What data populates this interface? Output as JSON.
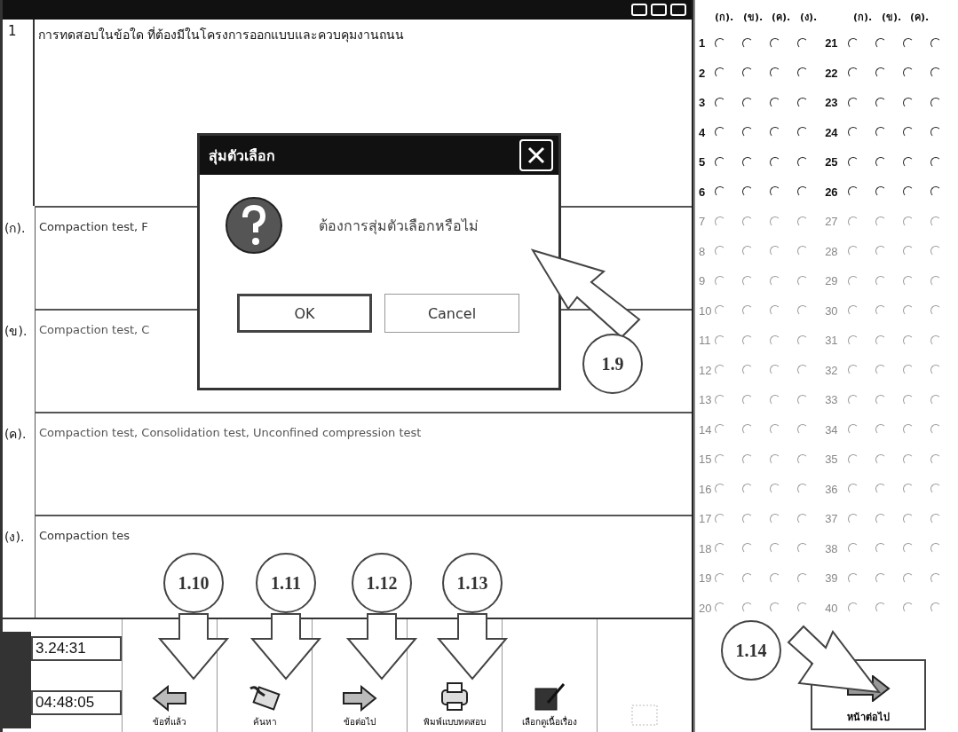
{
  "question": {
    "number": "1",
    "text": "การทดสอบในข้อใด ที่ต้องมีในโครงการออกแบบและควบคุมงานถนน"
  },
  "options": [
    {
      "label": "(ก).",
      "text": "Compaction test, F"
    },
    {
      "label": "(ข).",
      "text": "Compaction test, C"
    },
    {
      "label": "(ค).",
      "text": "Compaction test, Consolidation test, Unconfined compression test"
    },
    {
      "label": "(ง).",
      "text": "Compaction tes"
    }
  ],
  "dialog": {
    "title": "สุ่มตัวเลือก",
    "message": "ต้องการสุ่มตัวเลือกหรือไม่",
    "buttons": [
      "OK",
      "Cancel"
    ]
  },
  "timers": [
    "3.24:31",
    "04:48:05"
  ],
  "toolbar": [
    {
      "kind": "back",
      "label": "ข้อที่แล้ว"
    },
    {
      "kind": "search",
      "label": "ค้นหา"
    },
    {
      "kind": "next",
      "label": "ข้อต่อไป"
    },
    {
      "kind": "print",
      "label": "พิมพ์แบบทดสอบ"
    },
    {
      "kind": "story",
      "label": "เลือกดูเนื้อเรื่อง"
    },
    {
      "kind": "blank"
    }
  ],
  "answer_grid": {
    "headers": [
      "(ก).",
      "(ข).",
      "(ค).",
      "(ง)."
    ],
    "headers_right": [
      "(ก).",
      "(ข).",
      "(ค)."
    ],
    "rows": [
      {
        "left": {
          "number": "1",
          "disabled": false,
          "checked": [
            false,
            false,
            false,
            false
          ]
        },
        "right": {
          "number": "21",
          "disabled": false,
          "checked": [
            false,
            false,
            false,
            false
          ]
        }
      },
      {
        "left": {
          "number": "2",
          "disabled": false,
          "checked": [
            false,
            false,
            false,
            false
          ]
        },
        "right": {
          "number": "22",
          "disabled": false,
          "checked": [
            false,
            false,
            false,
            false
          ]
        }
      },
      {
        "left": {
          "number": "3",
          "disabled": false,
          "checked": [
            false,
            false,
            false,
            false
          ]
        },
        "right": {
          "number": "23",
          "disabled": false,
          "checked": [
            false,
            false,
            false,
            false
          ]
        }
      },
      {
        "left": {
          "number": "4",
          "disabled": false,
          "checked": [
            false,
            false,
            false,
            false
          ]
        },
        "right": {
          "number": "24",
          "disabled": false,
          "checked": [
            false,
            false,
            false,
            false
          ]
        }
      },
      {
        "left": {
          "number": "5",
          "disabled": false,
          "checked": [
            false,
            false,
            false,
            false
          ]
        },
        "right": {
          "number": "25",
          "disabled": false,
          "checked": [
            false,
            false,
            false,
            false
          ]
        }
      },
      {
        "left": {
          "number": "6",
          "disabled": false,
          "checked": [
            false,
            false,
            false,
            false
          ]
        },
        "right": {
          "number": "26",
          "disabled": false,
          "checked": [
            false,
            false,
            false,
            false
          ]
        }
      },
      {
        "left": {
          "number": "7",
          "disabled": true,
          "checked": [
            false,
            false,
            false,
            false
          ]
        },
        "right": {
          "number": "27",
          "disabled": true,
          "checked": [
            false,
            false,
            false,
            false
          ]
        }
      },
      {
        "left": {
          "number": "8",
          "disabled": true,
          "checked": [
            false,
            false,
            false,
            false
          ]
        },
        "right": {
          "number": "28",
          "disabled": true,
          "checked": [
            false,
            false,
            false,
            false
          ]
        }
      },
      {
        "left": {
          "number": "9",
          "disabled": true,
          "checked": [
            false,
            false,
            false,
            false
          ]
        },
        "right": {
          "number": "29",
          "disabled": true,
          "checked": [
            false,
            false,
            false,
            false
          ]
        }
      },
      {
        "left": {
          "number": "10",
          "disabled": true,
          "checked": [
            false,
            false,
            false,
            false
          ]
        },
        "right": {
          "number": "30",
          "disabled": true,
          "checked": [
            false,
            false,
            false,
            false
          ]
        }
      },
      {
        "left": {
          "number": "11",
          "disabled": true,
          "checked": [
            false,
            false,
            false,
            false
          ]
        },
        "right": {
          "number": "31",
          "disabled": true,
          "checked": [
            false,
            false,
            false,
            false
          ]
        }
      },
      {
        "left": {
          "number": "12",
          "disabled": true,
          "checked": [
            false,
            false,
            false,
            false
          ]
        },
        "right": {
          "number": "32",
          "disabled": true,
          "checked": [
            false,
            false,
            false,
            false
          ]
        }
      },
      {
        "left": {
          "number": "13",
          "disabled": true,
          "checked": [
            false,
            false,
            false,
            false
          ]
        },
        "right": {
          "number": "33",
          "disabled": true,
          "checked": [
            false,
            false,
            false,
            false
          ]
        }
      },
      {
        "left": {
          "number": "14",
          "disabled": true,
          "checked": [
            false,
            false,
            false,
            false
          ]
        },
        "right": {
          "number": "34",
          "disabled": true,
          "checked": [
            false,
            false,
            false,
            false
          ]
        }
      },
      {
        "left": {
          "number": "15",
          "disabled": true,
          "checked": [
            false,
            false,
            false,
            false
          ]
        },
        "right": {
          "number": "35",
          "disabled": true,
          "checked": [
            false,
            false,
            false,
            false
          ]
        }
      },
      {
        "left": {
          "number": "16",
          "disabled": true,
          "checked": [
            false,
            false,
            false,
            false
          ]
        },
        "right": {
          "number": "36",
          "disabled": true,
          "checked": [
            false,
            false,
            false,
            false
          ]
        }
      },
      {
        "left": {
          "number": "17",
          "disabled": true,
          "checked": [
            false,
            false,
            false,
            false
          ]
        },
        "right": {
          "number": "37",
          "disabled": true,
          "checked": [
            false,
            false,
            false,
            false
          ]
        }
      },
      {
        "left": {
          "number": "18",
          "disabled": true,
          "checked": [
            false,
            false,
            false,
            false
          ]
        },
        "right": {
          "number": "38",
          "disabled": true,
          "checked": [
            false,
            false,
            false,
            false
          ]
        }
      },
      {
        "left": {
          "number": "19",
          "disabled": true,
          "checked": [
            false,
            false,
            false,
            false
          ]
        },
        "right": {
          "number": "39",
          "disabled": true,
          "checked": [
            false,
            false,
            false,
            false
          ]
        }
      },
      {
        "left": {
          "number": "20",
          "disabled": true,
          "checked": [
            false,
            false,
            false,
            false
          ]
        },
        "right": {
          "number": "40",
          "disabled": true,
          "checked": [
            false,
            false,
            false,
            false
          ]
        }
      }
    ]
  },
  "next_page": {
    "label": "หน้าต่อไป"
  },
  "callouts": [
    {
      "label": "1.9",
      "kind": "up-left"
    },
    {
      "label": "1.10",
      "kind": "down"
    },
    {
      "label": "1.11",
      "kind": "down"
    },
    {
      "label": "1.12",
      "kind": "down"
    },
    {
      "label": "1.13",
      "kind": "down"
    },
    {
      "label": "1.14",
      "kind": "down-right"
    }
  ]
}
